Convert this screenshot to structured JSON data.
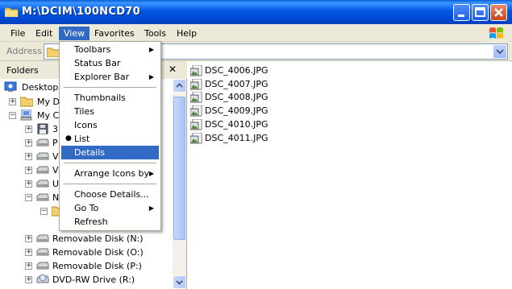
{
  "window": {
    "title": "M:\\DCIM\\100NCD70",
    "title_icon": "folder-icon",
    "buttons": [
      "minimize-icon",
      "maximize-icon",
      "close-icon"
    ]
  },
  "menubar": {
    "items": [
      "File",
      "Edit",
      "View",
      "Favorites",
      "Tools",
      "Help"
    ],
    "active": "View"
  },
  "addressbar": {
    "label": "Address"
  },
  "folders_pane": {
    "title": "Folders",
    "close": "✕",
    "tree": [
      {
        "label": "Desktop",
        "icon": "desktop-icon",
        "expander": ""
      },
      {
        "label": "My Do",
        "icon": "folder-icon",
        "expander": "+"
      },
      {
        "label": "My Co",
        "icon": "computer-icon",
        "expander": "−"
      },
      {
        "label": "3",
        "icon": "floppy-icon",
        "expander": "+"
      },
      {
        "label": "P",
        "icon": "drive-icon",
        "expander": "+"
      },
      {
        "label": "V",
        "icon": "drive-icon",
        "expander": "+"
      },
      {
        "label": "V",
        "icon": "drive-icon",
        "expander": "+"
      },
      {
        "label": "U",
        "icon": "drive-icon",
        "expander": "+"
      },
      {
        "label": "N",
        "icon": "drive-icon",
        "expander": "−"
      },
      {
        "label": "",
        "icon": "folder-icon",
        "expander": "−"
      },
      {
        "label": "",
        "icon": "",
        "expander": ""
      },
      {
        "label": "Removable Disk (N:)",
        "icon": "removable-disk-icon",
        "expander": "+"
      },
      {
        "label": "Removable Disk (O:)",
        "icon": "removable-disk-icon",
        "expander": "+"
      },
      {
        "label": "Removable Disk (P:)",
        "icon": "removable-disk-icon",
        "expander": "+"
      },
      {
        "label": "DVD-RW Drive (R:)",
        "icon": "dvd-drive-icon",
        "expander": "+"
      }
    ]
  },
  "files": [
    {
      "name": "DSC_4006.JPG",
      "icon": "jpg-image-icon"
    },
    {
      "name": "DSC_4007.JPG",
      "icon": "jpg-image-icon"
    },
    {
      "name": "DSC_4008.JPG",
      "icon": "jpg-image-icon"
    },
    {
      "name": "DSC_4009.JPG",
      "icon": "jpg-image-icon"
    },
    {
      "name": "DSC_4010.JPG",
      "icon": "jpg-image-icon"
    },
    {
      "name": "DSC_4011.JPG",
      "icon": "jpg-image-icon"
    }
  ],
  "view_menu": {
    "items": [
      {
        "label": "Toolbars",
        "submenu": true
      },
      {
        "label": "Status Bar"
      },
      {
        "label": "Explorer Bar",
        "submenu": true
      },
      {
        "separator": true
      },
      {
        "label": "Thumbnails"
      },
      {
        "label": "Tiles"
      },
      {
        "label": "Icons"
      },
      {
        "label": "List",
        "bullet": true
      },
      {
        "label": "Details",
        "highlighted": true
      },
      {
        "separator": true
      },
      {
        "label": "Arrange Icons by",
        "submenu": true
      },
      {
        "separator": true
      },
      {
        "label": "Choose Details..."
      },
      {
        "label": "Go To",
        "submenu": true
      },
      {
        "label": "Refresh"
      }
    ]
  },
  "colors": {
    "titlebar": "#0058e6",
    "menu_highlight": "#316ac5",
    "chrome": "#ece9d8"
  }
}
